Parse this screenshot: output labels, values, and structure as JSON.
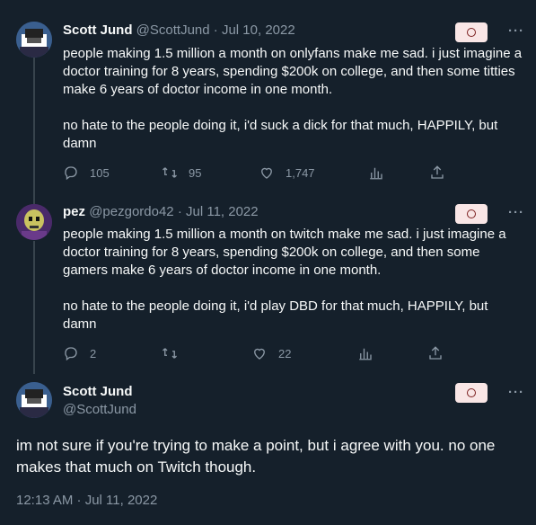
{
  "tweets": [
    {
      "name": "Scott Jund",
      "handle": "@ScottJund",
      "sep": "·",
      "date": "Jul 10, 2022",
      "paragraphs": [
        "people making 1.5 million a month on onlyfans make me sad. i just imagine a doctor training for 8 years, spending $200k on college, and then some titties make 6 years of doctor income in one month.",
        "no hate to the people doing it, i'd suck a dick for that much, HAPPILY, but damn"
      ],
      "replies": "105",
      "retweets": "95",
      "likes": "1,747"
    },
    {
      "name": "pez",
      "handle": "@pezgordo42",
      "sep": "·",
      "date": "Jul 11, 2022",
      "paragraphs": [
        "people making 1.5 million a month on twitch make me sad. i just imagine a doctor training for 8 years, spending $200k on college, and then some gamers make 6 years of doctor income in one month.",
        "no hate to the people doing it, i'd play DBD for that much, HAPPILY, but damn"
      ],
      "replies": "2",
      "retweets": "",
      "likes": "22"
    }
  ],
  "main_tweet": {
    "name": "Scott Jund",
    "handle": "@ScottJund",
    "text": "im not sure if you're trying to make a point, but i agree with you. no one makes that much on Twitch though.",
    "timestamp": "12:13 AM · Jul 11, 2022"
  },
  "more_glyph": "···",
  "icons": [
    "reply-icon",
    "retweet-icon",
    "like-icon",
    "views-icon",
    "share-icon",
    "more-icon"
  ],
  "colors": {
    "background": "#15202b",
    "text": "#f7f9f9",
    "muted": "#8b98a5",
    "thread_line": "#38444d"
  }
}
